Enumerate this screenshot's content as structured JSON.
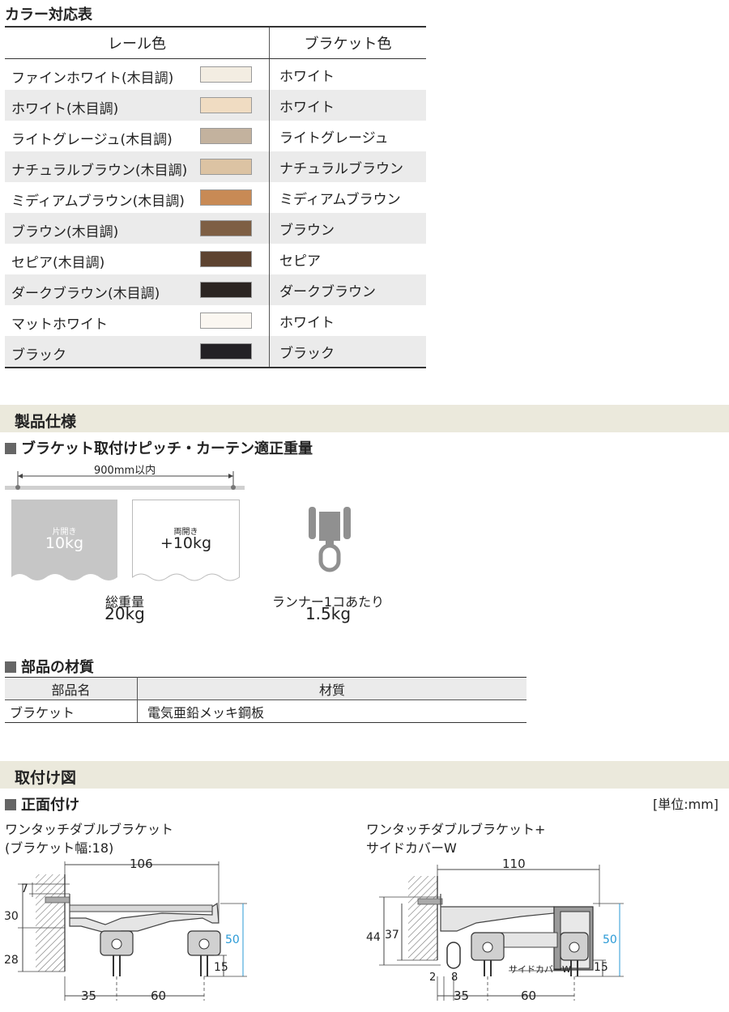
{
  "color_table": {
    "title": "カラー対応表",
    "header_rail": "レール色",
    "header_bracket": "ブラケット色",
    "rows": [
      {
        "rail": "ファインホワイト(木目調)",
        "bracket": "ホワイト",
        "swatch": "#f3ede2"
      },
      {
        "rail": "ホワイト(木目調)",
        "bracket": "ホワイト",
        "swatch": "#f0dcc2"
      },
      {
        "rail": "ライトグレージュ(木目調)",
        "bracket": "ライトグレージュ",
        "swatch": "#c3b29e"
      },
      {
        "rail": "ナチュラルブラウン(木目調)",
        "bracket": "ナチュラルブラウン",
        "swatch": "#dcc3a3"
      },
      {
        "rail": "ミディアムブラウン(木目調)",
        "bracket": "ミディアムブラウン",
        "swatch": "#c88a55"
      },
      {
        "rail": "ブラウン(木目調)",
        "bracket": "ブラウン",
        "swatch": "#7e5f44"
      },
      {
        "rail": "セピア(木目調)",
        "bracket": "セピア",
        "swatch": "#5d4330"
      },
      {
        "rail": "ダークブラウン(木目調)",
        "bracket": "ダークブラウン",
        "swatch": "#2c2522"
      },
      {
        "rail": "マットホワイト",
        "bracket": "ホワイト",
        "swatch": "#fbf7f1"
      },
      {
        "rail": "ブラック",
        "bracket": "ブラック",
        "swatch": "#232125"
      }
    ]
  },
  "spec": {
    "section_title": "製品仕様",
    "pitch_heading": "ブラケット取付けピッチ・カーテン適正重量",
    "pitch_label": "900mm以内",
    "single_label": "片開き",
    "single_value": "10kg",
    "double_label": "両開き",
    "double_value": "+10kg",
    "total_label": "総重量",
    "total_value": "20kg",
    "runner_label": "ランナー1コあたり",
    "runner_value": "1.5kg"
  },
  "materials": {
    "heading": "部品の材質",
    "col_part": "部品名",
    "col_material": "材質",
    "rows": [
      {
        "part": "ブラケット",
        "material": "電気亜鉛メッキ鋼板"
      }
    ]
  },
  "install": {
    "section_title": "取付け図",
    "front_heading": "正面付け",
    "unit": "[単位:mm]",
    "left": {
      "title": "ワンタッチダブルブラケット",
      "subtitle": "(ブラケット幅:18)",
      "dim_width": "106",
      "dim_7": "7",
      "dim_30": "30",
      "dim_28": "28",
      "dim_50": "50",
      "dim_15": "15",
      "dim_35": "35",
      "dim_60": "60"
    },
    "right": {
      "title": "ワンタッチダブルブラケット+",
      "subtitle": "サイドカバーW",
      "dim_width": "110",
      "dim_44": "44",
      "dim_37": "37",
      "dim_50": "50",
      "dim_15": "15",
      "dim_2": "2",
      "dim_8": "8",
      "dim_35": "35",
      "dim_60": "60",
      "cover_label": "サイドカバーW"
    }
  },
  "colors": {
    "dim_blue": "#2a9ad6",
    "section_bg": "#ebe9dc",
    "curtain_gray": "#c6c6c6"
  }
}
